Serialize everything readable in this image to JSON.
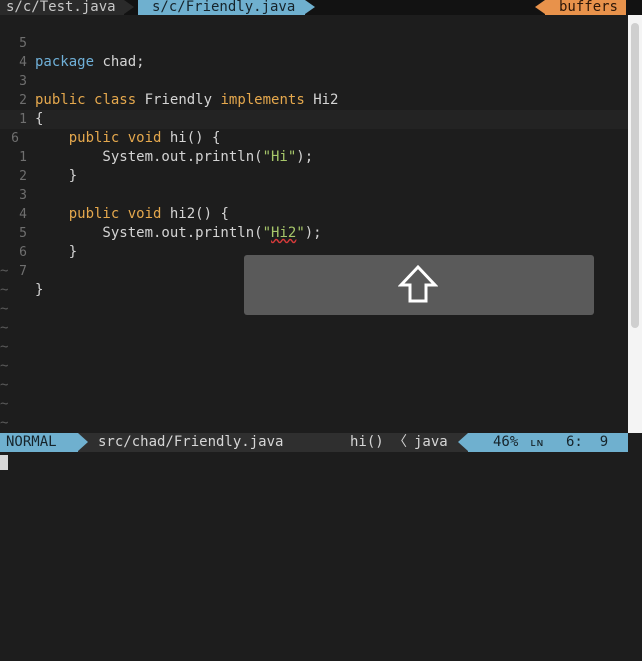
{
  "tabline": {
    "tabs": [
      {
        "label": "s/c/Test.java"
      },
      {
        "label": "s/c/Friendly.java"
      }
    ],
    "buffers_label": "buffers"
  },
  "editor": {
    "lines": [
      {
        "num": "5",
        "code": "package chad;"
      },
      {
        "num": "4",
        "code": ""
      },
      {
        "num": "3",
        "code": "public class Friendly implements Hi2"
      },
      {
        "num": "2",
        "code": "{"
      },
      {
        "num": "1",
        "code": "    public void hi() {"
      },
      {
        "num": "6",
        "code": "        System.out.println(\"Hi\");"
      },
      {
        "num": "1",
        "code": "    }"
      },
      {
        "num": "2",
        "code": ""
      },
      {
        "num": "3",
        "code": "    public void hi2() {"
      },
      {
        "num": "4",
        "code": "        System.out.println(\"Hi2\");"
      },
      {
        "num": "5",
        "code": "    }"
      },
      {
        "num": "6",
        "code": ""
      },
      {
        "num": "7",
        "code": "}"
      }
    ],
    "tilde": "~"
  },
  "statusline": {
    "mode": "NORMAL",
    "filepath": "src/chad/Friendly.java",
    "function": "hi()",
    "separator": "〈",
    "filetype": "java",
    "percent": "46%",
    "ln_icon": "ʟɴ",
    "linecol": "6:  9"
  },
  "overlay": {
    "icon": "arrow-up-outline-icon"
  },
  "colors": {
    "accent_blue": "#6fb0cf",
    "accent_orange": "#e8924b",
    "keyword": "#e5a84d",
    "string": "#a7c76a"
  }
}
